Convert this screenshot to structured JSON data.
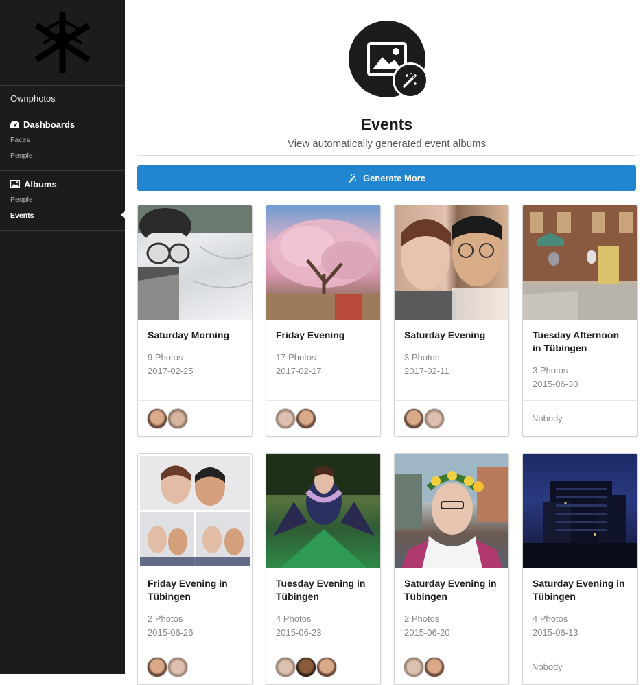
{
  "sidebar": {
    "brand": "Ownphotos",
    "sections": [
      {
        "header": "Dashboards",
        "icon": "dashboard-icon",
        "items": [
          "Faces",
          "People"
        ]
      },
      {
        "header": "Albums",
        "icon": "image-icon",
        "items": [
          "People",
          "Events"
        ]
      }
    ],
    "active_item": "Events"
  },
  "hero": {
    "title": "Events",
    "subtitle": "View automatically generated event albums",
    "icon": "image-icon",
    "badge_icon": "magic-wand-icon"
  },
  "generate_button": {
    "label": "Generate More",
    "icon": "magic-wand-icon",
    "color": "#2185d0"
  },
  "events": [
    {
      "title": "Saturday Morning",
      "count": "9 Photos",
      "date": "2017-02-25",
      "people": 2,
      "nobody_label": ""
    },
    {
      "title": "Friday Evening",
      "count": "17 Photos",
      "date": "2017-02-17",
      "people": 2,
      "nobody_label": ""
    },
    {
      "title": "Saturday Evening",
      "count": "3 Photos",
      "date": "2017-02-11",
      "people": 2,
      "nobody_label": ""
    },
    {
      "title": "Tuesday Afternoon in Tübingen",
      "count": "3 Photos",
      "date": "2015-06-30",
      "people": 0,
      "nobody_label": "Nobody"
    },
    {
      "title": "Friday Evening in Tübingen",
      "count": "2 Photos",
      "date": "2015-06-26",
      "people": 2,
      "nobody_label": ""
    },
    {
      "title": "Tuesday Evening in Tübingen",
      "count": "4 Photos",
      "date": "2015-06-23",
      "people": 3,
      "nobody_label": ""
    },
    {
      "title": "Saturday Evening in Tübingen",
      "count": "2 Photos",
      "date": "2015-06-20",
      "people": 2,
      "nobody_label": ""
    },
    {
      "title": "Saturday Evening in Tübingen",
      "count": "4 Photos",
      "date": "2015-06-13",
      "people": 0,
      "nobody_label": "Nobody"
    }
  ]
}
